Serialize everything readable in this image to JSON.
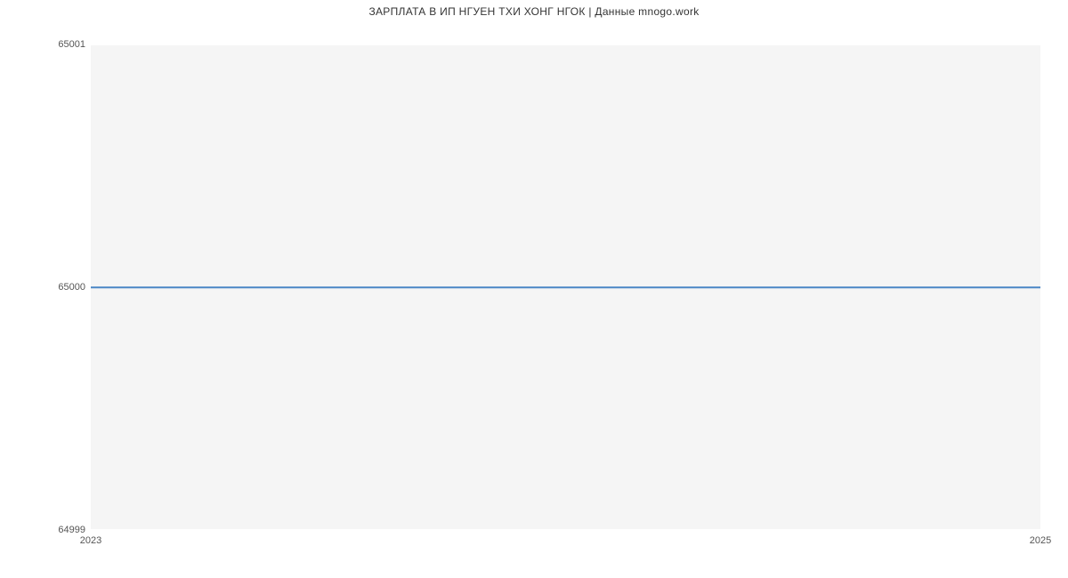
{
  "chart_data": {
    "type": "line",
    "title": "ЗАРПЛАТА В ИП НГУЕН ТХИ ХОНГ НГОК | Данные mnogo.work",
    "x": [
      2023,
      2025
    ],
    "values": [
      65000,
      65000
    ],
    "xlabel": "",
    "ylabel": "",
    "xlim": [
      2023,
      2025
    ],
    "ylim": [
      64999,
      65001
    ],
    "x_ticks": [
      2023,
      2025
    ],
    "y_ticks": [
      64999,
      65000,
      65001
    ],
    "line_color": "#4a86c5",
    "background_color": "#f5f5f5"
  }
}
